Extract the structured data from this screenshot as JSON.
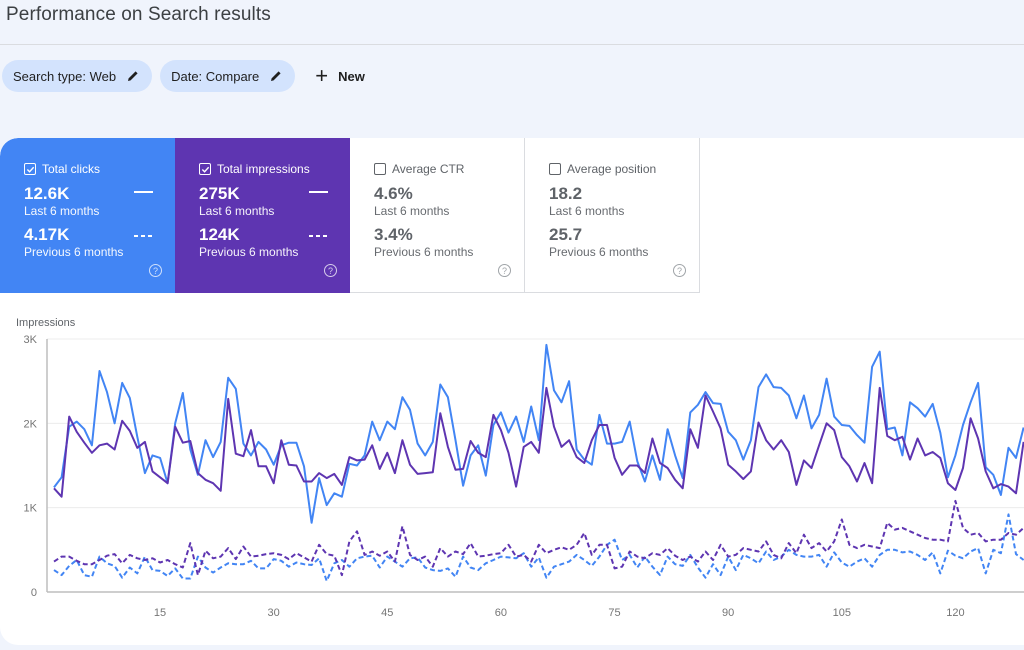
{
  "header": {
    "title": "Performance on Search results"
  },
  "filters": [
    {
      "label": "Search type: Web",
      "icon": "pencil-icon"
    },
    {
      "label": "Date: Compare",
      "icon": "pencil-icon"
    }
  ],
  "new_button": {
    "label": "New",
    "icon": "plus-icon"
  },
  "metrics": [
    {
      "name": "total-clicks",
      "label": "Total clicks",
      "checked": true,
      "current_value": "12.6K",
      "current_label": "Last 6 months",
      "previous_value": "4.17K",
      "previous_label": "Previous 6 months",
      "color": "#4285f4"
    },
    {
      "name": "total-impressions",
      "label": "Total impressions",
      "checked": true,
      "current_value": "275K",
      "current_label": "Last 6 months",
      "previous_value": "124K",
      "previous_label": "Previous 6 months",
      "color": "#5e35b1"
    },
    {
      "name": "average-ctr",
      "label": "Average CTR",
      "checked": false,
      "current_value": "4.6%",
      "current_label": "Last 6 months",
      "previous_value": "3.4%",
      "previous_label": "Previous 6 months",
      "color": "#ffffff"
    },
    {
      "name": "average-position",
      "label": "Average position",
      "checked": false,
      "current_value": "18.2",
      "current_label": "Last 6 months",
      "previous_value": "25.7",
      "previous_label": "Previous 6 months",
      "color": "#ffffff"
    }
  ],
  "chart_data": {
    "type": "line",
    "title": "",
    "ylabel": "Impressions",
    "xlabel": "",
    "ylim": [
      0,
      3000
    ],
    "yticks": [
      0,
      1000,
      2000,
      3000
    ],
    "ytick_labels": [
      "0",
      "1K",
      "2K",
      "3K"
    ],
    "xticks": [
      15,
      30,
      45,
      60,
      75,
      90,
      105,
      120
    ],
    "xlim": [
      1,
      129
    ],
    "grid": true,
    "legend": "none",
    "series": [
      {
        "name": "Clicks (Last 6 months)",
        "color": "#4285f4",
        "dashed": false,
        "values": [
          1240,
          1360,
          1960,
          2020,
          1930,
          1740,
          2620,
          2370,
          2000,
          2480,
          2300,
          1840,
          1410,
          1620,
          1590,
          1290,
          2000,
          2360,
          1690,
          1390,
          1800,
          1600,
          1780,
          2540,
          2410,
          1760,
          1620,
          1780,
          1690,
          1510,
          1740,
          1770,
          1770,
          1490,
          820,
          1350,
          1030,
          1170,
          1130,
          1520,
          1500,
          1620,
          2020,
          1800,
          2020,
          1930,
          2310,
          2160,
          1760,
          1620,
          1780,
          2460,
          2310,
          1800,
          1260,
          1620,
          1740,
          1380,
          1980,
          2130,
          1890,
          2080,
          1780,
          2200,
          1800,
          2930,
          2390,
          2250,
          2500,
          1690,
          1570,
          1510,
          2100,
          1760,
          1760,
          1780,
          2020,
          1550,
          1310,
          1620,
          1330,
          1930,
          1620,
          1350,
          2130,
          2220,
          2370,
          2240,
          2230,
          1900,
          1800,
          1570,
          1800,
          2430,
          2580,
          2430,
          2420,
          2330,
          2060,
          2330,
          1940,
          2100,
          2530,
          2080,
          1980,
          1970,
          1860,
          1770,
          2670,
          2850,
          1930,
          1950,
          1620,
          2250,
          2180,
          2080,
          2230,
          1890,
          1360,
          1620,
          1980,
          2250,
          2480,
          1480,
          1390,
          1150,
          1710,
          1590,
          1950
        ]
      },
      {
        "name": "Impressions (Last 6 months)",
        "color": "#5e35b1",
        "dashed": false,
        "values": [
          1230,
          1130,
          2080,
          1900,
          1770,
          1650,
          1740,
          1760,
          1690,
          2030,
          1910,
          1710,
          1780,
          1430,
          1360,
          1290,
          1960,
          1770,
          1790,
          1410,
          1330,
          1290,
          1200,
          2290,
          1640,
          1610,
          1920,
          1490,
          1490,
          1290,
          1800,
          1510,
          1500,
          1310,
          1310,
          1410,
          1350,
          1400,
          1270,
          1600,
          1560,
          1570,
          1740,
          1460,
          1650,
          1410,
          1800,
          1510,
          1400,
          1410,
          1420,
          2120,
          1720,
          1450,
          1460,
          1790,
          1650,
          1600,
          2100,
          1920,
          1650,
          1250,
          1720,
          1780,
          1650,
          2420,
          1960,
          1720,
          1800,
          1600,
          1530,
          1800,
          1980,
          1980,
          1590,
          1390,
          1500,
          1500,
          1410,
          1820,
          1530,
          1470,
          1330,
          1230,
          1930,
          1710,
          2330,
          2140,
          1940,
          1510,
          1430,
          1340,
          1430,
          2010,
          1800,
          1690,
          1800,
          1660,
          1270,
          1560,
          1470,
          1740,
          2000,
          1920,
          1600,
          1490,
          1310,
          1530,
          1290,
          2420,
          1850,
          1800,
          1840,
          1570,
          1820,
          1620,
          1660,
          1590,
          1290,
          1210,
          1470,
          2060,
          1820,
          1430,
          1230,
          1280,
          1250,
          1170,
          1780
        ]
      },
      {
        "name": "Clicks (Previous 6 months)",
        "color": "#4285f4",
        "dashed": true,
        "values": [
          260,
          200,
          310,
          380,
          200,
          180,
          420,
          340,
          310,
          170,
          290,
          220,
          420,
          260,
          250,
          190,
          280,
          160,
          160,
          420,
          290,
          230,
          290,
          340,
          330,
          330,
          370,
          280,
          280,
          390,
          370,
          300,
          350,
          330,
          320,
          400,
          130,
          340,
          380,
          300,
          400,
          420,
          430,
          290,
          420,
          360,
          300,
          400,
          410,
          290,
          260,
          250,
          280,
          180,
          420,
          290,
          260,
          340,
          380,
          420,
          410,
          400,
          460,
          300,
          410,
          170,
          300,
          330,
          360,
          440,
          380,
          310,
          420,
          560,
          620,
          380,
          440,
          290,
          420,
          300,
          200,
          420,
          330,
          310,
          440,
          290,
          170,
          330,
          200,
          420,
          260,
          440,
          400,
          340,
          480,
          380,
          420,
          500,
          440,
          420,
          420,
          440,
          300,
          470,
          350,
          300,
          360,
          400,
          300,
          440,
          500,
          500,
          470,
          480,
          440,
          380,
          470,
          220,
          490,
          430,
          400,
          480,
          520,
          220,
          500,
          460,
          920,
          450,
          380
        ]
      },
      {
        "name": "Impressions (Previous 6 months)",
        "color": "#5e35b1",
        "dashed": true,
        "values": [
          360,
          420,
          420,
          370,
          330,
          330,
          380,
          430,
          450,
          340,
          440,
          400,
          380,
          400,
          350,
          380,
          330,
          290,
          580,
          200,
          490,
          400,
          420,
          520,
          390,
          540,
          420,
          430,
          450,
          460,
          440,
          390,
          460,
          410,
          360,
          560,
          450,
          430,
          200,
          600,
          720,
          440,
          480,
          430,
          480,
          360,
          780,
          440,
          380,
          420,
          300,
          520,
          420,
          480,
          450,
          580,
          420,
          430,
          450,
          460,
          560,
          420,
          440,
          360,
          560,
          460,
          500,
          530,
          500,
          560,
          700,
          440,
          560,
          560,
          280,
          300,
          480,
          420,
          400,
          460,
          440,
          520,
          430,
          380,
          420,
          360,
          480,
          380,
          560,
          420,
          440,
          520,
          500,
          480,
          600,
          440,
          400,
          580,
          460,
          680,
          520,
          580,
          480,
          600,
          860,
          560,
          520,
          560,
          540,
          520,
          820,
          740,
          760,
          720,
          680,
          640,
          620,
          620,
          600,
          1080,
          760,
          680,
          700,
          600,
          620,
          620,
          700,
          680,
          760
        ]
      }
    ]
  }
}
